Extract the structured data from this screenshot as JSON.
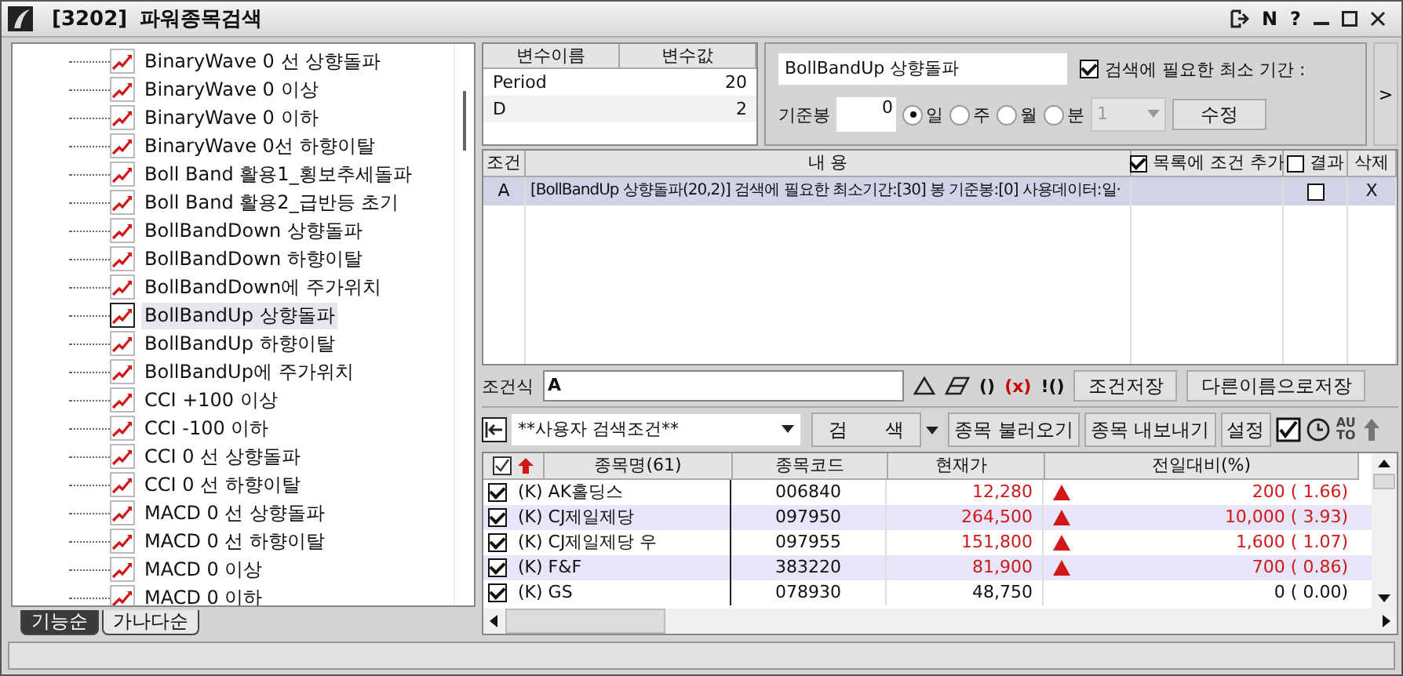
{
  "window": {
    "code": "[3202]",
    "title": "파워종목검색",
    "help_buttons": [
      "N",
      "?"
    ]
  },
  "tree": {
    "items": [
      {
        "label": "BinaryWave 0 선 상향돌파",
        "selected": false
      },
      {
        "label": "BinaryWave 0 이상",
        "selected": false
      },
      {
        "label": "BinaryWave 0 이하",
        "selected": false
      },
      {
        "label": "BinaryWave 0선 하향이탈",
        "selected": false
      },
      {
        "label": "Boll Band 활용1_횡보추세돌파",
        "selected": false
      },
      {
        "label": "Boll Band 활용2_급반등 초기",
        "selected": false
      },
      {
        "label": "BollBandDown 상향돌파",
        "selected": false
      },
      {
        "label": "BollBandDown 하향이탈",
        "selected": false
      },
      {
        "label": "BollBandDown에 주가위치",
        "selected": false
      },
      {
        "label": "BollBandUp 상향돌파",
        "selected": true
      },
      {
        "label": "BollBandUp 하향이탈",
        "selected": false
      },
      {
        "label": "BollBandUp에 주가위치",
        "selected": false
      },
      {
        "label": "CCI +100 이상",
        "selected": false
      },
      {
        "label": "CCI -100 이하",
        "selected": false
      },
      {
        "label": "CCI 0 선 상향돌파",
        "selected": false
      },
      {
        "label": "CCI 0 선 하향이탈",
        "selected": false
      },
      {
        "label": "MACD 0 선 상향돌파",
        "selected": false
      },
      {
        "label": "MACD 0 선 하향이탈",
        "selected": false
      },
      {
        "label": "MACD 0 이상",
        "selected": false
      },
      {
        "label": "MACD 0 이하",
        "selected": false
      }
    ]
  },
  "sort_tabs": [
    {
      "label": "기능순",
      "selected": true
    },
    {
      "label": "가나다순",
      "selected": false
    }
  ],
  "variables": {
    "columns": [
      "변수이름",
      "변수값"
    ],
    "rows": [
      {
        "name": "Period",
        "value": "20"
      },
      {
        "name": "D",
        "value": "2"
      }
    ]
  },
  "settings": {
    "name": "BollBandUp 상향돌파",
    "min_period": {
      "label": "검색에 필요한 최소 기간 :",
      "checked": true
    },
    "base_label": "기준봉",
    "base_value": "0",
    "periods": [
      {
        "label": "일",
        "selected": true
      },
      {
        "label": "주",
        "selected": false
      },
      {
        "label": "월",
        "selected": false
      },
      {
        "label": "분",
        "selected": false
      }
    ],
    "minute_value": "1",
    "modify_button": "수정",
    "expand_button": ">"
  },
  "conditions": {
    "columns": [
      {
        "label": "조건"
      },
      {
        "label": "내          용"
      },
      {
        "label": "목록에 조건 추가",
        "checked": true
      },
      {
        "label": "결과",
        "checked": false
      },
      {
        "label": "삭제"
      }
    ],
    "rows": [
      {
        "id": "A",
        "content": "[BollBandUp 상향돌파(20,2)] 검색에 필요한 최소기간:[30] 봉  기준봉:[0] 사용데이터:일·",
        "result_checked": false,
        "delete": "X",
        "selected": true
      }
    ]
  },
  "formula": {
    "label": "조건식",
    "value": "A",
    "tools": [
      "()",
      "(x)",
      "!()"
    ],
    "buttons": [
      "조건저장",
      "다른이름으로저장"
    ]
  },
  "toolbar": {
    "preset": "**사용자 검색조건**",
    "search_button": "검　　색",
    "buttons": [
      "종목 불러오기",
      "종목 내보내기",
      "설정"
    ],
    "auto_label": "AU TO"
  },
  "stocks": {
    "columns": [
      "종목명(61)",
      "종목코드",
      "현재가",
      "전일대비(%)"
    ],
    "rows": [
      {
        "checked": true,
        "name": "(K) AK홀딩스",
        "code": "006840",
        "price": "12,280",
        "up": true,
        "change": "200 ( 1.66)"
      },
      {
        "checked": true,
        "name": "(K) CJ제일제당",
        "code": "097950",
        "price": "264,500",
        "up": true,
        "change": "10,000 ( 3.93)"
      },
      {
        "checked": true,
        "name": "(K) CJ제일제당 우",
        "code": "097955",
        "price": "151,800",
        "up": true,
        "change": "1,600 ( 1.07)"
      },
      {
        "checked": true,
        "name": "(K) F&F",
        "code": "383220",
        "price": "81,900",
        "up": true,
        "change": "700 ( 0.86)"
      },
      {
        "checked": true,
        "name": "(K) GS",
        "code": "078930",
        "price": "48,750",
        "up": false,
        "change": "0 ( 0.00)"
      }
    ]
  }
}
